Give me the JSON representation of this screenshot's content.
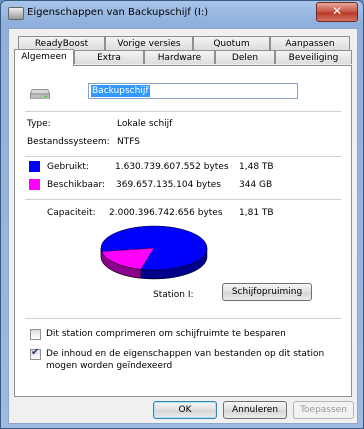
{
  "window": {
    "title": "Eigenschappen van Backupschijf (I:)",
    "close_glyph": "✕"
  },
  "tabs": {
    "row1": [
      "ReadyBoost",
      "Vorige versies",
      "Quotum",
      "Aanpassen"
    ],
    "row2": [
      "Algemeen",
      "Extra",
      "Hardware",
      "Delen",
      "Beveiliging"
    ],
    "active": "Algemeen"
  },
  "general": {
    "drive_name": "Backupschijf",
    "type_label": "Type:",
    "type_value": "Lokale schijf",
    "fs_label": "Bestandssysteem:",
    "fs_value": "NTFS",
    "used_label": "Gebruikt:",
    "used_bytes": "1.630.739.607.552 bytes",
    "used_size": "1,48 TB",
    "free_label": "Beschikbaar:",
    "free_bytes": "369.657.135.104 bytes",
    "free_size": "344 GB",
    "capacity_label": "Capaciteit:",
    "capacity_bytes": "2.000.396.742.656 bytes",
    "capacity_size": "1,81 TB",
    "station_label": "Station I:",
    "cleanup_button": "Schijfopruiming",
    "compress_label": "Dit station comprimeren om schijfruimte te besparen",
    "compress_checked": false,
    "index_label_line1": "De inhoud en de eigenschappen van bestanden op dit station",
    "index_label_line2": "mogen worden geïndexeerd",
    "index_checked": true,
    "used_fraction": 0.8152
  },
  "colors": {
    "used": "#0000ff",
    "free": "#ff00ff"
  },
  "footer": {
    "ok": "OK",
    "cancel": "Annuleren",
    "apply": "Toepassen"
  }
}
